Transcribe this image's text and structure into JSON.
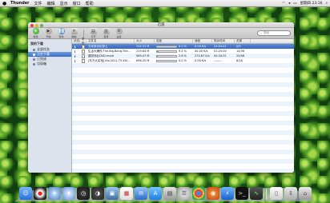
{
  "menubar": {
    "app_name": "Thunder",
    "items": [
      "文件",
      "编辑",
      "显示",
      "窗口",
      "帮助"
    ],
    "clock": "星期四 23:16",
    "status_icons": [
      "wifi-icon",
      "volume-icon",
      "battery-icon",
      "spotlight-icon"
    ]
  },
  "window": {
    "title": "迅雷",
    "toolbar": {
      "buttons": [
        {
          "label": "新建",
          "icon": "plus-icon"
        },
        {
          "label": "开始",
          "icon": "play-icon"
        },
        {
          "label": "暂停",
          "icon": "pause-icon"
        },
        {
          "label": "删除",
          "icon": "delete-icon"
        },
        {
          "label": "打开",
          "icon": "folder-icon"
        },
        {
          "label": "目录",
          "icon": "directory-icon"
        },
        {
          "label": "设置",
          "icon": "gear-icon"
        }
      ],
      "search_placeholder": "搜索"
    },
    "sidebar": {
      "header": "我的下载",
      "items": [
        {
          "label": "全部任务",
          "active": false
        },
        {
          "label": "正在下载",
          "active": true
        },
        {
          "label": "已完成",
          "active": false
        },
        {
          "label": "垃圾箱",
          "active": false
        }
      ]
    },
    "table": {
      "columns": [
        "状态",
        "类型",
        "文件名",
        "大小",
        "进度",
        "速度",
        "剩余时间",
        "资源"
      ],
      "rows": [
        {
          "name": "文本采访纪录上",
          "size": "702.31 M",
          "progress_text": "0.0 %",
          "progress": 0.0,
          "speed": "0.00 K/s",
          "remaining": "24:04:41",
          "sources": "0/0",
          "selected": true
        },
        {
          "name": "生活大爆炸.The.Big.Bang.The...",
          "size": "219.64 M",
          "progress_text": "9.4 %",
          "progress": 0.094,
          "speed": "40.00 K/s",
          "remaining": "01:25:00",
          "sources": "14/36",
          "selected": false
        },
        {
          "name": "建党伟业DVD.rmvb",
          "size": "569.47 M",
          "progress_text": "2.6 %",
          "progress": 0.026,
          "speed": "274.67 K/s",
          "remaining": "00:34:31",
          "sources": "20/56",
          "selected": false
        },
        {
          "name": "[东方大买电].Kio.2011.T5.XVi...",
          "size": "696.25 M",
          "progress_text": "0.0 %",
          "progress": 0.0,
          "speed": "0.00 K/s",
          "remaining": "--:--:--",
          "sources": "8/18",
          "selected": false
        }
      ]
    }
  },
  "dock": {
    "icons": [
      "finder-icon",
      "qq-icon",
      "launchpad-icon",
      "safari-icon",
      "clock-icon",
      "dashboard-icon",
      "photo-icon",
      "calendar-icon",
      "mail-icon",
      "app-store-icon",
      "preview-icon",
      "database-icon",
      "chrome-icon",
      "firefox-icon",
      "thunder-icon",
      "terminal-icon",
      "activity-monitor-icon",
      "document-icon",
      "downloads-icon",
      "trash-icon"
    ]
  },
  "colors": {
    "selection": "#3a6fc9",
    "progress_fill": "#3c78d8",
    "wallpaper": "#1e5a18"
  }
}
